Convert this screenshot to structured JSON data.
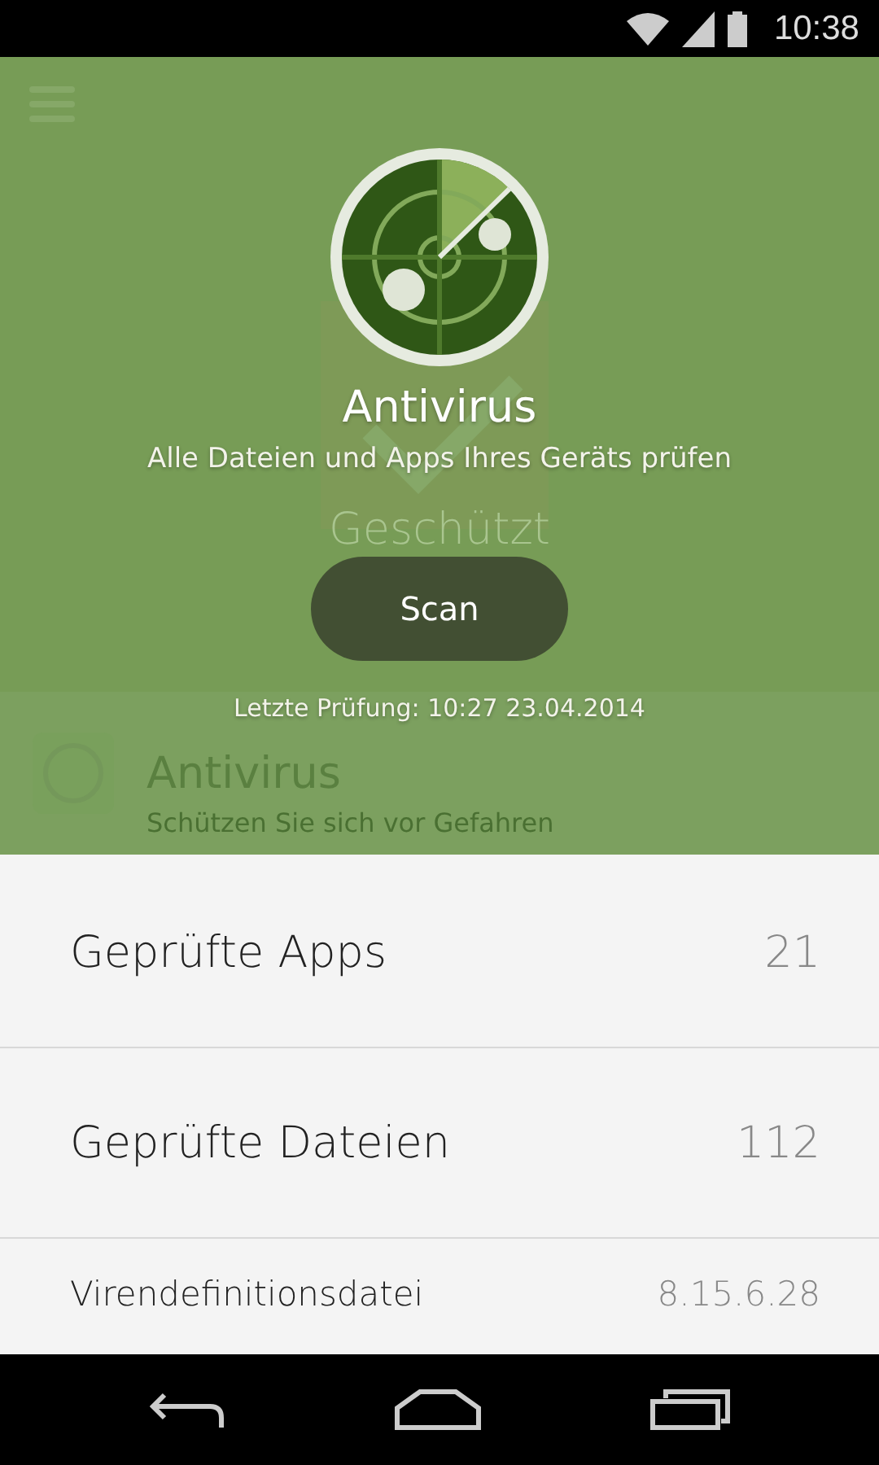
{
  "status_bar": {
    "time": "10:38"
  },
  "background": {
    "status_label": "Geschützt",
    "card": {
      "title": "Antivirus",
      "subtitle": "Schützen Sie sich vor Gefahren"
    }
  },
  "overlay": {
    "title": "Antivirus",
    "subtitle": "Alle Dateien und Apps Ihres Geräts prüfen",
    "scan_button": "Scan",
    "last_check": "Letzte Prüfung: 10:27 23.04.2014"
  },
  "stats": [
    {
      "kind": "large",
      "label": "Geprüfte Apps",
      "value": "21"
    },
    {
      "kind": "large",
      "label": "Geprüfte Dateien",
      "value": "112"
    },
    {
      "kind": "small",
      "label": "Virendefinitionsdatei",
      "value": "8.15.6.28"
    }
  ]
}
